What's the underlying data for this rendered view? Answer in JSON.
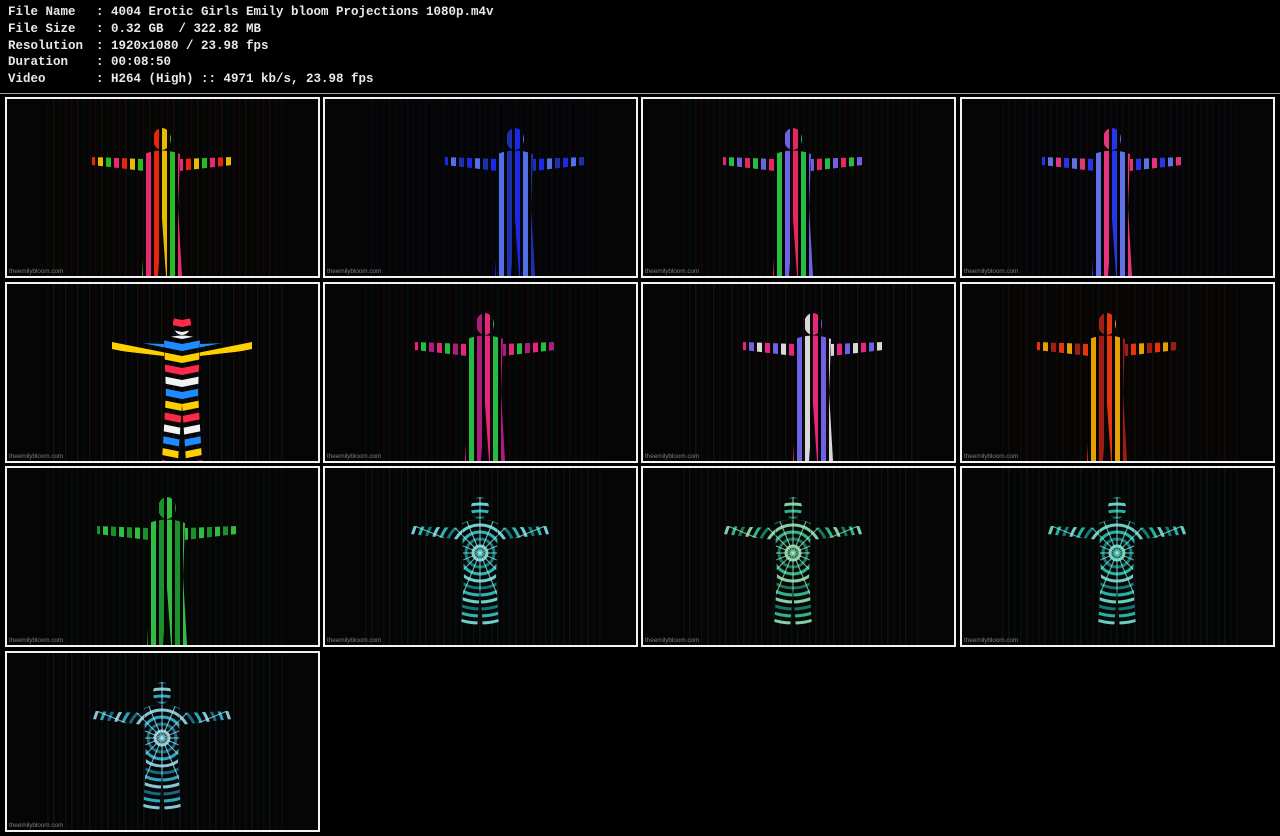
{
  "info": {
    "rows": [
      {
        "key": "File Name",
        "sep": ":",
        "value": "4004 Erotic Girls Emily bloom Projections 1080p.m4v"
      },
      {
        "key": "File Size",
        "sep": ":",
        "value": "0.32 GB  / 322.82 MB"
      },
      {
        "key": "Resolution",
        "sep": ":",
        "value": "1920x1080 / 23.98 fps"
      },
      {
        "key": "Duration",
        "sep": ":",
        "value": "00:08:50"
      },
      {
        "key": "Video",
        "sep": ":",
        "value": "H264 (High) :: 4971 kb/s, 23.98 fps"
      }
    ]
  },
  "thumbnails": {
    "watermark": "theemilybloom.com",
    "items": [
      {
        "palette": [
          "#ff2a10",
          "#ffd000",
          "#29d02a",
          "#ff3080"
        ],
        "pattern": "stripes"
      },
      {
        "palette": [
          "#1e2cff",
          "#5a7bff",
          "#2036c0"
        ],
        "pattern": "stripes"
      },
      {
        "palette": [
          "#ff2a6a",
          "#2ad04a",
          "#7a6cff"
        ],
        "pattern": "stripes"
      },
      {
        "palette": [
          "#2a3cff",
          "#6a7cff",
          "#ff3a8a"
        ],
        "pattern": "stripes"
      },
      {
        "palette": [
          "#ff2a4a",
          "#f2f2f2",
          "#1e8cff",
          "#ffd000"
        ],
        "pattern": "chevron"
      },
      {
        "palette": [
          "#ff2a8a",
          "#2ad04a",
          "#c0208a"
        ],
        "pattern": "stripes"
      },
      {
        "palette": [
          "#ff2a8a",
          "#7a6cff",
          "#f0f0f0"
        ],
        "pattern": "stripes"
      },
      {
        "palette": [
          "#ff3a10",
          "#ffb000",
          "#b0201a"
        ],
        "pattern": "stripes"
      },
      {
        "palette": [
          "#1ea030",
          "#38d04a"
        ],
        "pattern": "stripes"
      },
      {
        "palette": [
          "#3ad0d0",
          "#8af0f0",
          "#1a8a8a"
        ],
        "pattern": "mandala"
      },
      {
        "palette": [
          "#3ad0a0",
          "#a0f0c0",
          "#1a8a6a"
        ],
        "pattern": "mandala"
      },
      {
        "palette": [
          "#2ad0c0",
          "#80f0e0",
          "#1a8a8a"
        ],
        "pattern": "mandala"
      },
      {
        "palette": [
          "#3ac0e0",
          "#a0e8f8",
          "#1a7a9a"
        ],
        "pattern": "mandala"
      }
    ]
  }
}
